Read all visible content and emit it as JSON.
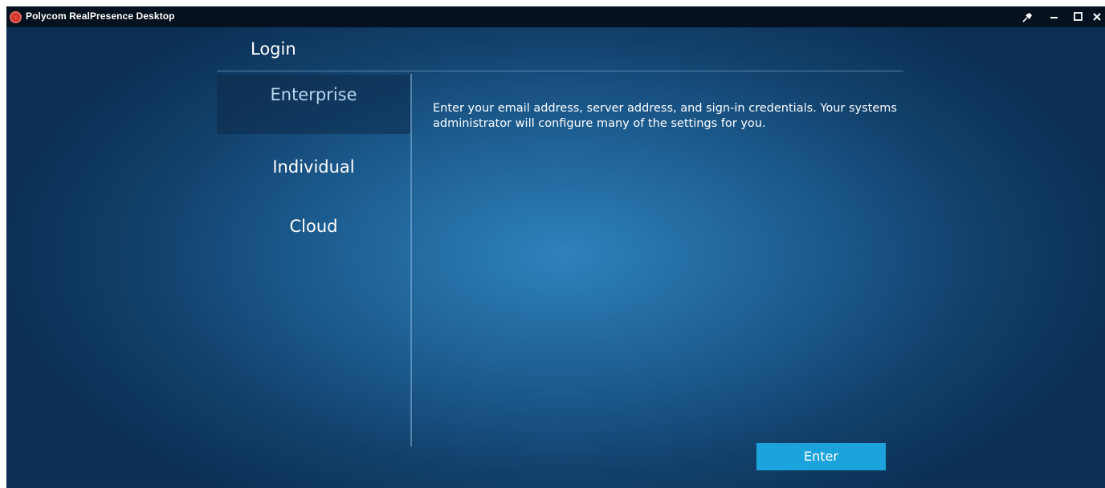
{
  "window": {
    "title": "Polycom RealPresence Desktop",
    "controls": {
      "pin_icon": "pin-icon",
      "minimize_icon": "minimize-icon",
      "maximize_icon": "maximize-icon",
      "close_icon": "close-icon"
    }
  },
  "login": {
    "heading": "Login",
    "tabs": [
      {
        "label": "Enterprise",
        "selected": true
      },
      {
        "label": "Individual",
        "selected": false
      },
      {
        "label": "Cloud",
        "selected": false
      }
    ],
    "description": "Enter your email address, server address, and sign-in credentials. Your systems administrator will configure many of the settings for you.",
    "enter_button": "Enter"
  },
  "colors": {
    "titlebar": "#05111f",
    "background_center": "#2e82bb",
    "background_edge": "#0b2e52",
    "enter_button": "#1ca3db",
    "logo": "#c42b22"
  }
}
